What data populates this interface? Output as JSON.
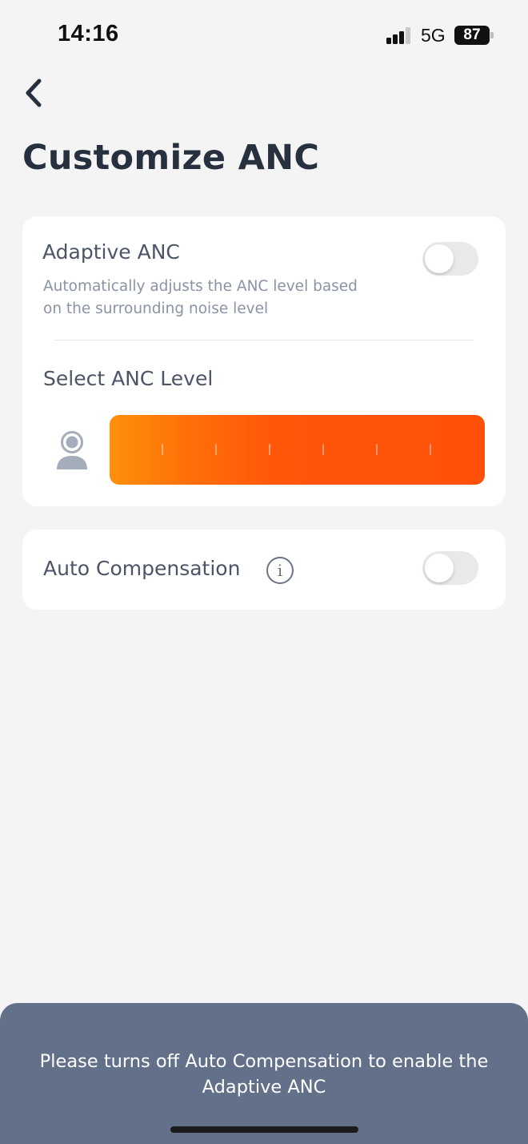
{
  "status_bar": {
    "time": "14:16",
    "network": "5G",
    "battery": "87"
  },
  "header": {
    "back_icon": "chevron-left-icon",
    "title": "Customize ANC"
  },
  "adaptive_anc": {
    "title": "Adaptive ANC",
    "description": "Automatically adjusts the ANC level based on the surrounding noise level",
    "toggle_on": false
  },
  "anc_level": {
    "label": "Select ANC Level",
    "icon": "person-icon",
    "tick_count": 6,
    "gradient_start": "#ff8f0b",
    "gradient_end": "#ff500a"
  },
  "auto_compensation": {
    "title": "Auto Compensation",
    "info_icon": "info-icon",
    "info_glyph": "i",
    "toggle_on": false
  },
  "toast": {
    "message": "Please turns off Auto Compensation to enable the Adaptive ANC",
    "background": "#627189"
  },
  "colors": {
    "page_background": "#f4f4f4",
    "card_background": "#ffffff",
    "title_text": "#27303e",
    "muted_text": "#8a93a5"
  }
}
